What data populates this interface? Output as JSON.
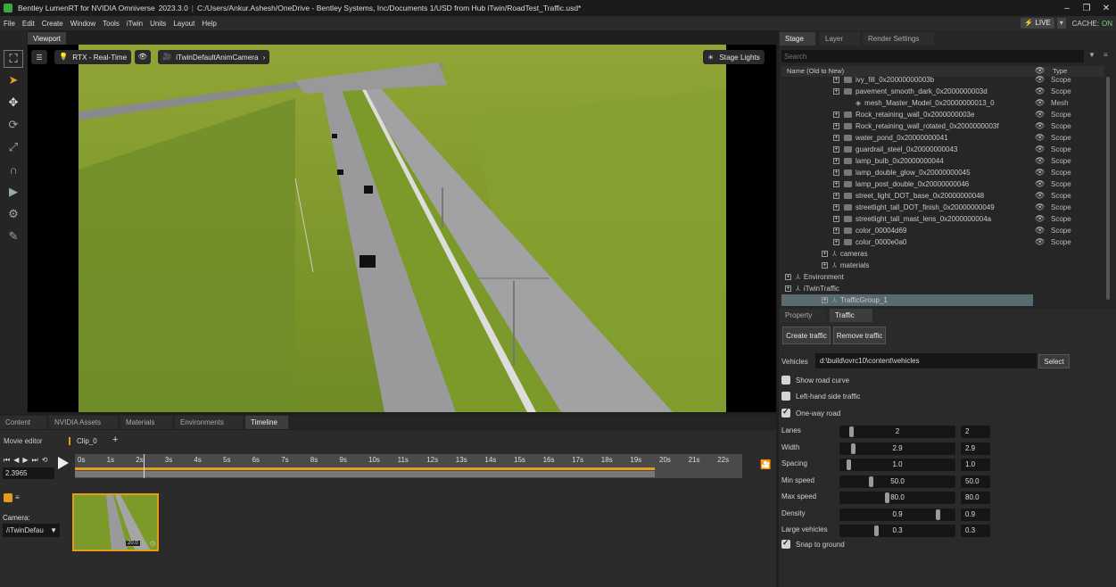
{
  "title_bar": {
    "app_name": "Bentley LumenRT for NVIDIA Omniverse",
    "version": "2023.3.0",
    "file_path": "C:/Users/Ankur.Ashesh/OneDrive - Bentley Systems, Inc/Documents 1/USD from Hub iTwin/RoadTest_Traffic.usd*",
    "live_label": "LIVE",
    "cache_label": "CACHE:",
    "cache_state": "ON"
  },
  "menu": [
    "File",
    "Edit",
    "Create",
    "Window",
    "Tools",
    "iTwin",
    "Units",
    "Layout",
    "Help"
  ],
  "viewport": {
    "tab": "Viewport",
    "renderer": "RTX - Real-Time",
    "camera": "iTwinDefaultAnimCamera",
    "stage_lights": "Stage Lights"
  },
  "bottom_tabs": [
    "Content",
    "NVIDIA Assets",
    "Materials",
    "Environments",
    "Timeline"
  ],
  "timeline": {
    "movie_editor": "Movie editor",
    "clip": "Clip_0",
    "add": "+",
    "current_time": "2.3965",
    "ticks": [
      "0s",
      "1s",
      "2s",
      "3s",
      "4s",
      "5s",
      "6s",
      "7s",
      "8s",
      "9s",
      "10s",
      "11s",
      "12s",
      "13s",
      "14s",
      "15s",
      "16s",
      "17s",
      "18s",
      "19s",
      "20s",
      "21s",
      "22s"
    ],
    "camera_label": "Camera:",
    "camera_value": "/iTwinDefau",
    "thumb_value": "20.0"
  },
  "stage": {
    "tabs": [
      "Stage",
      "Layer",
      "Render Settings"
    ],
    "search_placeholder": "Search",
    "col_name": "Name (Old to New)",
    "col_type": "Type",
    "rows": [
      {
        "name": "ivy_fill_0x20000000003b",
        "type": "Scope",
        "indent": 2,
        "kind": "folder"
      },
      {
        "name": "pavement_smooth_dark_0x2000000003d",
        "type": "Scope",
        "indent": 2,
        "kind": "folder"
      },
      {
        "name": "mesh_Master_Model_0x20000000013_0",
        "type": "Mesh",
        "indent": 3,
        "kind": "mesh"
      },
      {
        "name": "Rock_retaining_wall_0x2000000003e",
        "type": "Scope",
        "indent": 2,
        "kind": "folder"
      },
      {
        "name": "Rock_retaining_wall_rotated_0x2000000003f",
        "type": "Scope",
        "indent": 2,
        "kind": "folder"
      },
      {
        "name": "water_pond_0x20000000041",
        "type": "Scope",
        "indent": 2,
        "kind": "folder"
      },
      {
        "name": "guardrail_steel_0x20000000043",
        "type": "Scope",
        "indent": 2,
        "kind": "folder"
      },
      {
        "name": "lamp_bulb_0x20000000044",
        "type": "Scope",
        "indent": 2,
        "kind": "folder"
      },
      {
        "name": "lamp_double_glow_0x20000000045",
        "type": "Scope",
        "indent": 2,
        "kind": "folder"
      },
      {
        "name": "lamp_post_double_0x20000000046",
        "type": "Scope",
        "indent": 2,
        "kind": "folder"
      },
      {
        "name": "street_light_DOT_base_0x20000000048",
        "type": "Scope",
        "indent": 2,
        "kind": "folder"
      },
      {
        "name": "streetlight_tall_DOT_finish_0x20000000049",
        "type": "Scope",
        "indent": 2,
        "kind": "folder"
      },
      {
        "name": "streetlight_tall_mast_lens_0x2000000004a",
        "type": "Scope",
        "indent": 2,
        "kind": "folder"
      },
      {
        "name": "color_00004d69",
        "type": "Scope",
        "indent": 2,
        "kind": "folder"
      },
      {
        "name": "color_0000e0a0",
        "type": "Scope",
        "indent": 2,
        "kind": "folder"
      },
      {
        "name": "cameras",
        "type": "",
        "indent": 1,
        "kind": "xform"
      },
      {
        "name": "materials",
        "type": "",
        "indent": 1,
        "kind": "xform"
      },
      {
        "name": "Environment",
        "type": "",
        "indent": 0,
        "kind": "xform"
      },
      {
        "name": "iTwinTraffic",
        "type": "",
        "indent": 0,
        "kind": "xform"
      },
      {
        "name": "TrafficGroup_1",
        "type": "",
        "indent": 1,
        "kind": "xform",
        "selected": true
      }
    ]
  },
  "property": {
    "tabs": [
      "Property",
      "Traffic"
    ],
    "create_traffic": "Create traffic",
    "remove_traffic": "Remove traffic",
    "vehicles_label": "Vehicles",
    "vehicles_path": "d:\\build\\ovrc10\\content\\vehicles",
    "select": "Select",
    "show_road_curve": {
      "label": "Show road curve",
      "checked": false
    },
    "left_hand": {
      "label": "Left-hand side traffic",
      "checked": false
    },
    "one_way": {
      "label": "One-way road",
      "checked": true
    },
    "sliders": [
      {
        "label": "Lanes",
        "value": "2",
        "num": "2",
        "frac": 0.07
      },
      {
        "label": "Width",
        "value": "2.9",
        "num": "2.9",
        "frac": 0.09
      },
      {
        "label": "Spacing",
        "value": "1.0",
        "num": "1.0",
        "frac": 0.05
      },
      {
        "label": "Min speed",
        "value": "50.0",
        "num": "50.0",
        "frac": 0.25
      },
      {
        "label": "Max speed",
        "value": "80.0",
        "num": "80.0",
        "frac": 0.4
      },
      {
        "label": "Density",
        "value": "0.9",
        "num": "0.9",
        "frac": 0.87
      },
      {
        "label": "Large vehicles",
        "value": "0.3",
        "num": "0.3",
        "frac": 0.3
      }
    ],
    "snap": {
      "label": "Snap to ground",
      "checked": true
    }
  },
  "colors": {
    "accent_orange": "#e39d1b",
    "live": "#f0c020",
    "cache_on": "#7fd37f",
    "grass": "#7d9a2c",
    "road": "#9a9a9c"
  }
}
